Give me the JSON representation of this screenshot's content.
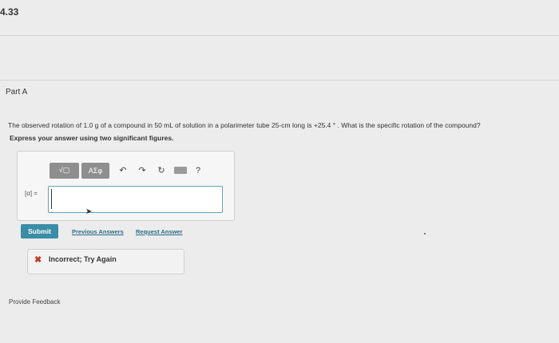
{
  "header": {
    "problem_number": "4.33"
  },
  "part": {
    "label": "Part A"
  },
  "question": {
    "text": "The observed rotation of 1.0 g of a compound in 50 mL of solution in a polarimeter tube 25-cm long is +25.4 ° . What is the specific rotation of the compound?",
    "instruction": "Express your answer using two significant figures."
  },
  "toolbar": {
    "template_label": "√▢",
    "greek_label": "ΑΣφ",
    "undo_symbol": "↶",
    "redo_symbol": "↷",
    "reset_symbol": "↻",
    "help_symbol": "?"
  },
  "answer": {
    "label": "[α] =",
    "value": ""
  },
  "actions": {
    "submit_label": "Submit",
    "previous_answers_label": "Previous Answers",
    "request_answer_label": "Request Answer"
  },
  "feedback": {
    "status_text": "Incorrect; Try Again",
    "status_color": "#c0392b"
  },
  "footer": {
    "provide_feedback_label": "Provide Feedback"
  }
}
